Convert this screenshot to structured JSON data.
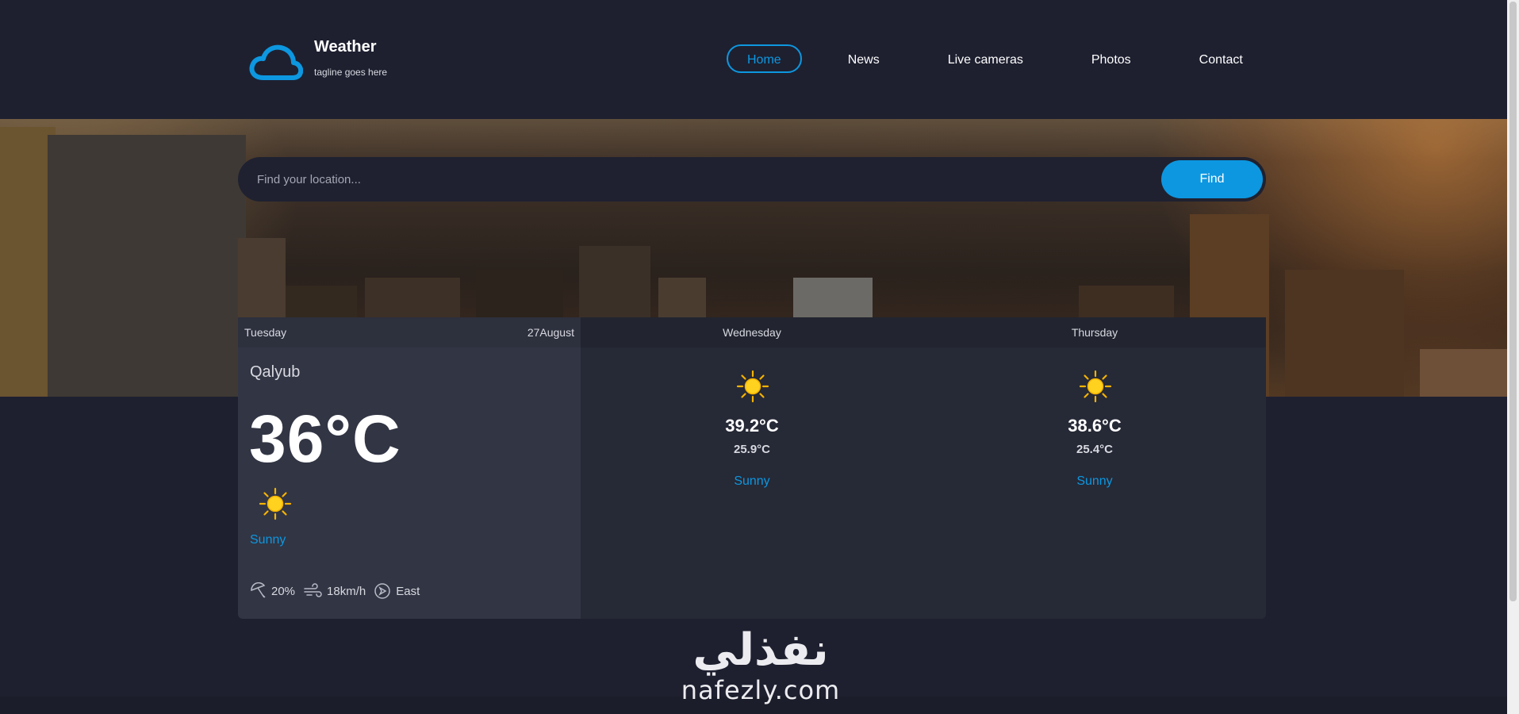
{
  "brand": {
    "title": "Weather",
    "tagline": "tagline goes here",
    "accent": "#0d97e0"
  },
  "nav": [
    {
      "label": "Home",
      "active": true
    },
    {
      "label": "News"
    },
    {
      "label": "Live cameras"
    },
    {
      "label": "Photos"
    },
    {
      "label": "Contact"
    }
  ],
  "search": {
    "placeholder": "Find your location...",
    "button": "Find"
  },
  "today": {
    "day": "Tuesday",
    "date": "27August",
    "location": "Qalyub",
    "temp": "36°C",
    "icon": "sun-icon",
    "condition": "Sunny",
    "humidity": "20%",
    "wind": "18km/h",
    "direction": "East"
  },
  "forecast": [
    {
      "day": "Wednesday",
      "icon": "sun-icon",
      "high": "39.2°C",
      "low": "25.9°C",
      "condition": "Sunny"
    },
    {
      "day": "Thursday",
      "icon": "sun-icon",
      "high": "38.6°C",
      "low": "25.4°C",
      "condition": "Sunny"
    }
  ],
  "watermark": {
    "arabic": "نفذلي",
    "latin": "nafezly.com"
  }
}
